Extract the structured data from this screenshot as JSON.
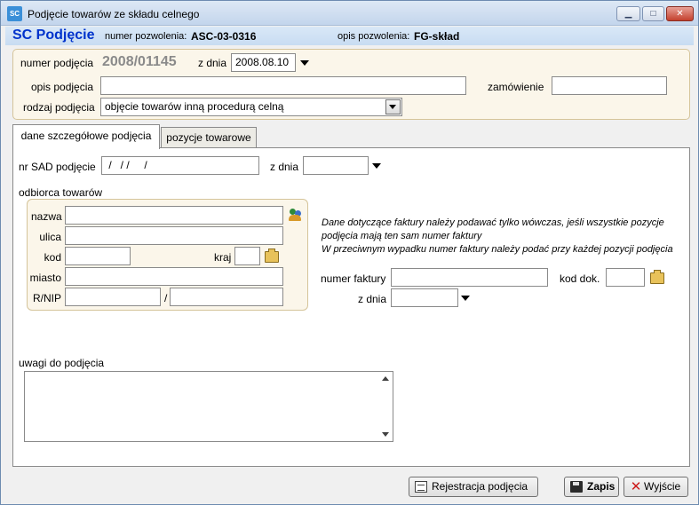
{
  "window": {
    "app_icon": "SC",
    "title": "Podjęcie towarów ze składu celnego",
    "min_icon": "minimize-icon",
    "max_icon": "maximize-icon",
    "close_icon": "close-icon"
  },
  "header": {
    "title": "SC Podjęcie",
    "permit_number_label": "numer pozwolenia:",
    "permit_number": "ASC-03-0316",
    "permit_desc_label": "opis pozwolenia:",
    "permit_desc": "FG-skład"
  },
  "top": {
    "number_label": "numer podjęcia",
    "number_value": "2008/01145",
    "date_label": "z dnia",
    "date_value": "2008.08.10",
    "desc_label": "opis podjęcia",
    "desc_value": "",
    "order_label": "zamówienie",
    "order_value": "",
    "type_label": "rodzaj podjęcia",
    "type_value": "objęcie towarów inną procedurą celną"
  },
  "tabs": [
    {
      "label": "dane szczegółowe podjęcia",
      "active": true
    },
    {
      "label": "pozycje towarowe",
      "active": false
    }
  ],
  "details": {
    "sad_label": "nr SAD podjęcie",
    "sad_value": " /   / /     /",
    "sad_date_label": "z dnia",
    "sad_date_value": "",
    "recipient_label": "odbiorca towarów",
    "name_label": "nazwa",
    "street_label": "ulica",
    "code_label": "kod",
    "country_label": "kraj",
    "city_label": "miasto",
    "nip_label": "R/NIP",
    "nip_separator": "/",
    "info_line1": "Dane dotyczące faktury należy podawać tylko wówczas, jeśli wszystkie pozycje",
    "info_line2": "podjęcia mają ten sam numer faktury",
    "info_line3": "W przeciwnym wypadku numer faktury należy podać przy każdej pozycji podjęcia",
    "invoice_label": "numer faktury",
    "doc_code_label": "kod dok.",
    "invoice_date_label": "z dnia",
    "notes_label": "uwagi do podjęcia"
  },
  "buttons": {
    "register": "Rejestracja podjęcia",
    "save": "Zapis",
    "exit": "Wyjście"
  },
  "colors": {
    "header_title": "#0033cc",
    "panel_bg": "#fbf6ea",
    "panel_border": "#d5c49a",
    "exit_icon": "#cc1a1a"
  }
}
